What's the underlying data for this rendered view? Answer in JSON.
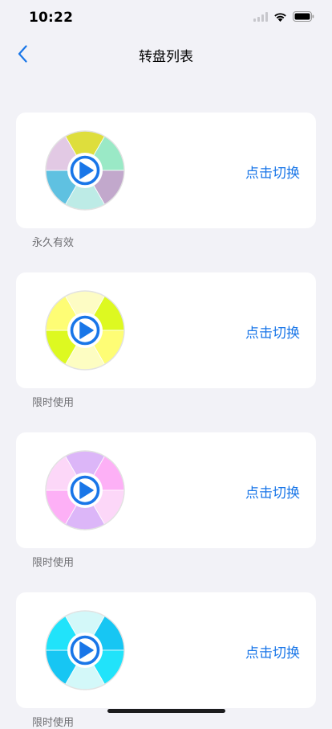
{
  "status_bar": {
    "time": "10:22"
  },
  "nav": {
    "title": "转盘列表",
    "back_icon": "chevron-left-icon"
  },
  "colors": {
    "accent": "#1976e8",
    "background": "#f2f2f7"
  },
  "wheels": [
    {
      "caption": "永久有效",
      "button_label": "点击切换",
      "colors": [
        "#dede3c",
        "#9ae9c6",
        "#c2a8cc",
        "#bdebe6",
        "#5fc1e1",
        "#e2c9e4"
      ]
    },
    {
      "caption": "限时使用",
      "button_label": "点击切换",
      "colors": [
        "#fdfcc4",
        "#ddf921",
        "#fefd75",
        "#fdfdc2",
        "#ddf921",
        "#fefd75"
      ]
    },
    {
      "caption": "限时使用",
      "button_label": "点击切换",
      "colors": [
        "#dcb6f8",
        "#fdb0f6",
        "#fcd7f8",
        "#dcb6f8",
        "#fdb0f6",
        "#fcd7f8"
      ]
    },
    {
      "caption": "限时使用",
      "button_label": "点击切换",
      "colors": [
        "#d3f8f9",
        "#17c6f3",
        "#21e3fa",
        "#d3f8f9",
        "#17c6f3",
        "#21e3fa"
      ]
    }
  ]
}
